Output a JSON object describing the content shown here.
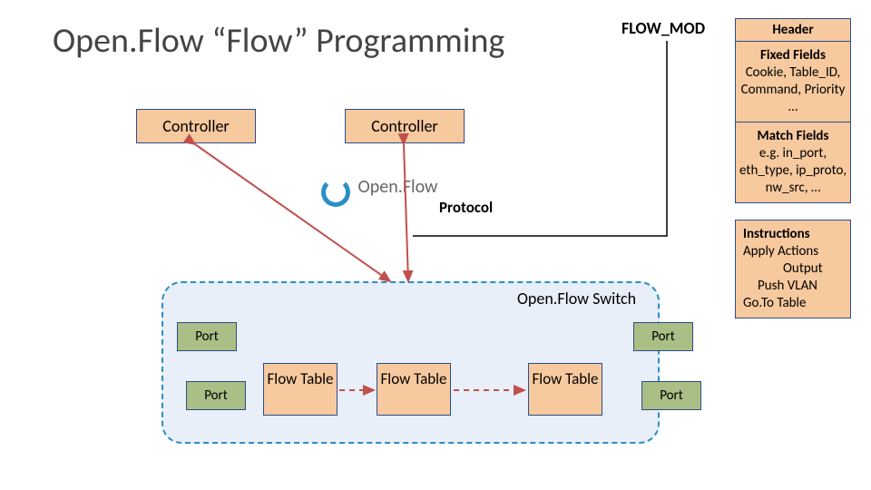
{
  "title": "Open.Flow “Flow” Programming",
  "controllers": {
    "left": "Controller",
    "right": "Controller"
  },
  "openflow_text": "Open.Flow",
  "protocol_label": "Protocol",
  "switch_label": "Open.Flow Switch",
  "ports": {
    "p1": "Port",
    "p2": "Port",
    "p3": "Port",
    "p4": "Port"
  },
  "flow_tables": {
    "t1": "Flow Table",
    "t2": "Flow Table",
    "t3": "Flow Table"
  },
  "flowmod_label": "FLOW_MOD",
  "sidebar": {
    "header": "Header",
    "fixed_title": "Fixed Fields",
    "fixed_body": "Cookie, Table_ID, Command, Priority …",
    "match_title": "Match Fields",
    "match_body": "e.g. in_port, eth_type, ip_proto, nw_src, …",
    "instr_title": "Instructions",
    "instr_l1": "Apply Actions",
    "instr_l2": "Output",
    "instr_l3": "Push VLAN",
    "instr_l4": "Go.To Table"
  }
}
